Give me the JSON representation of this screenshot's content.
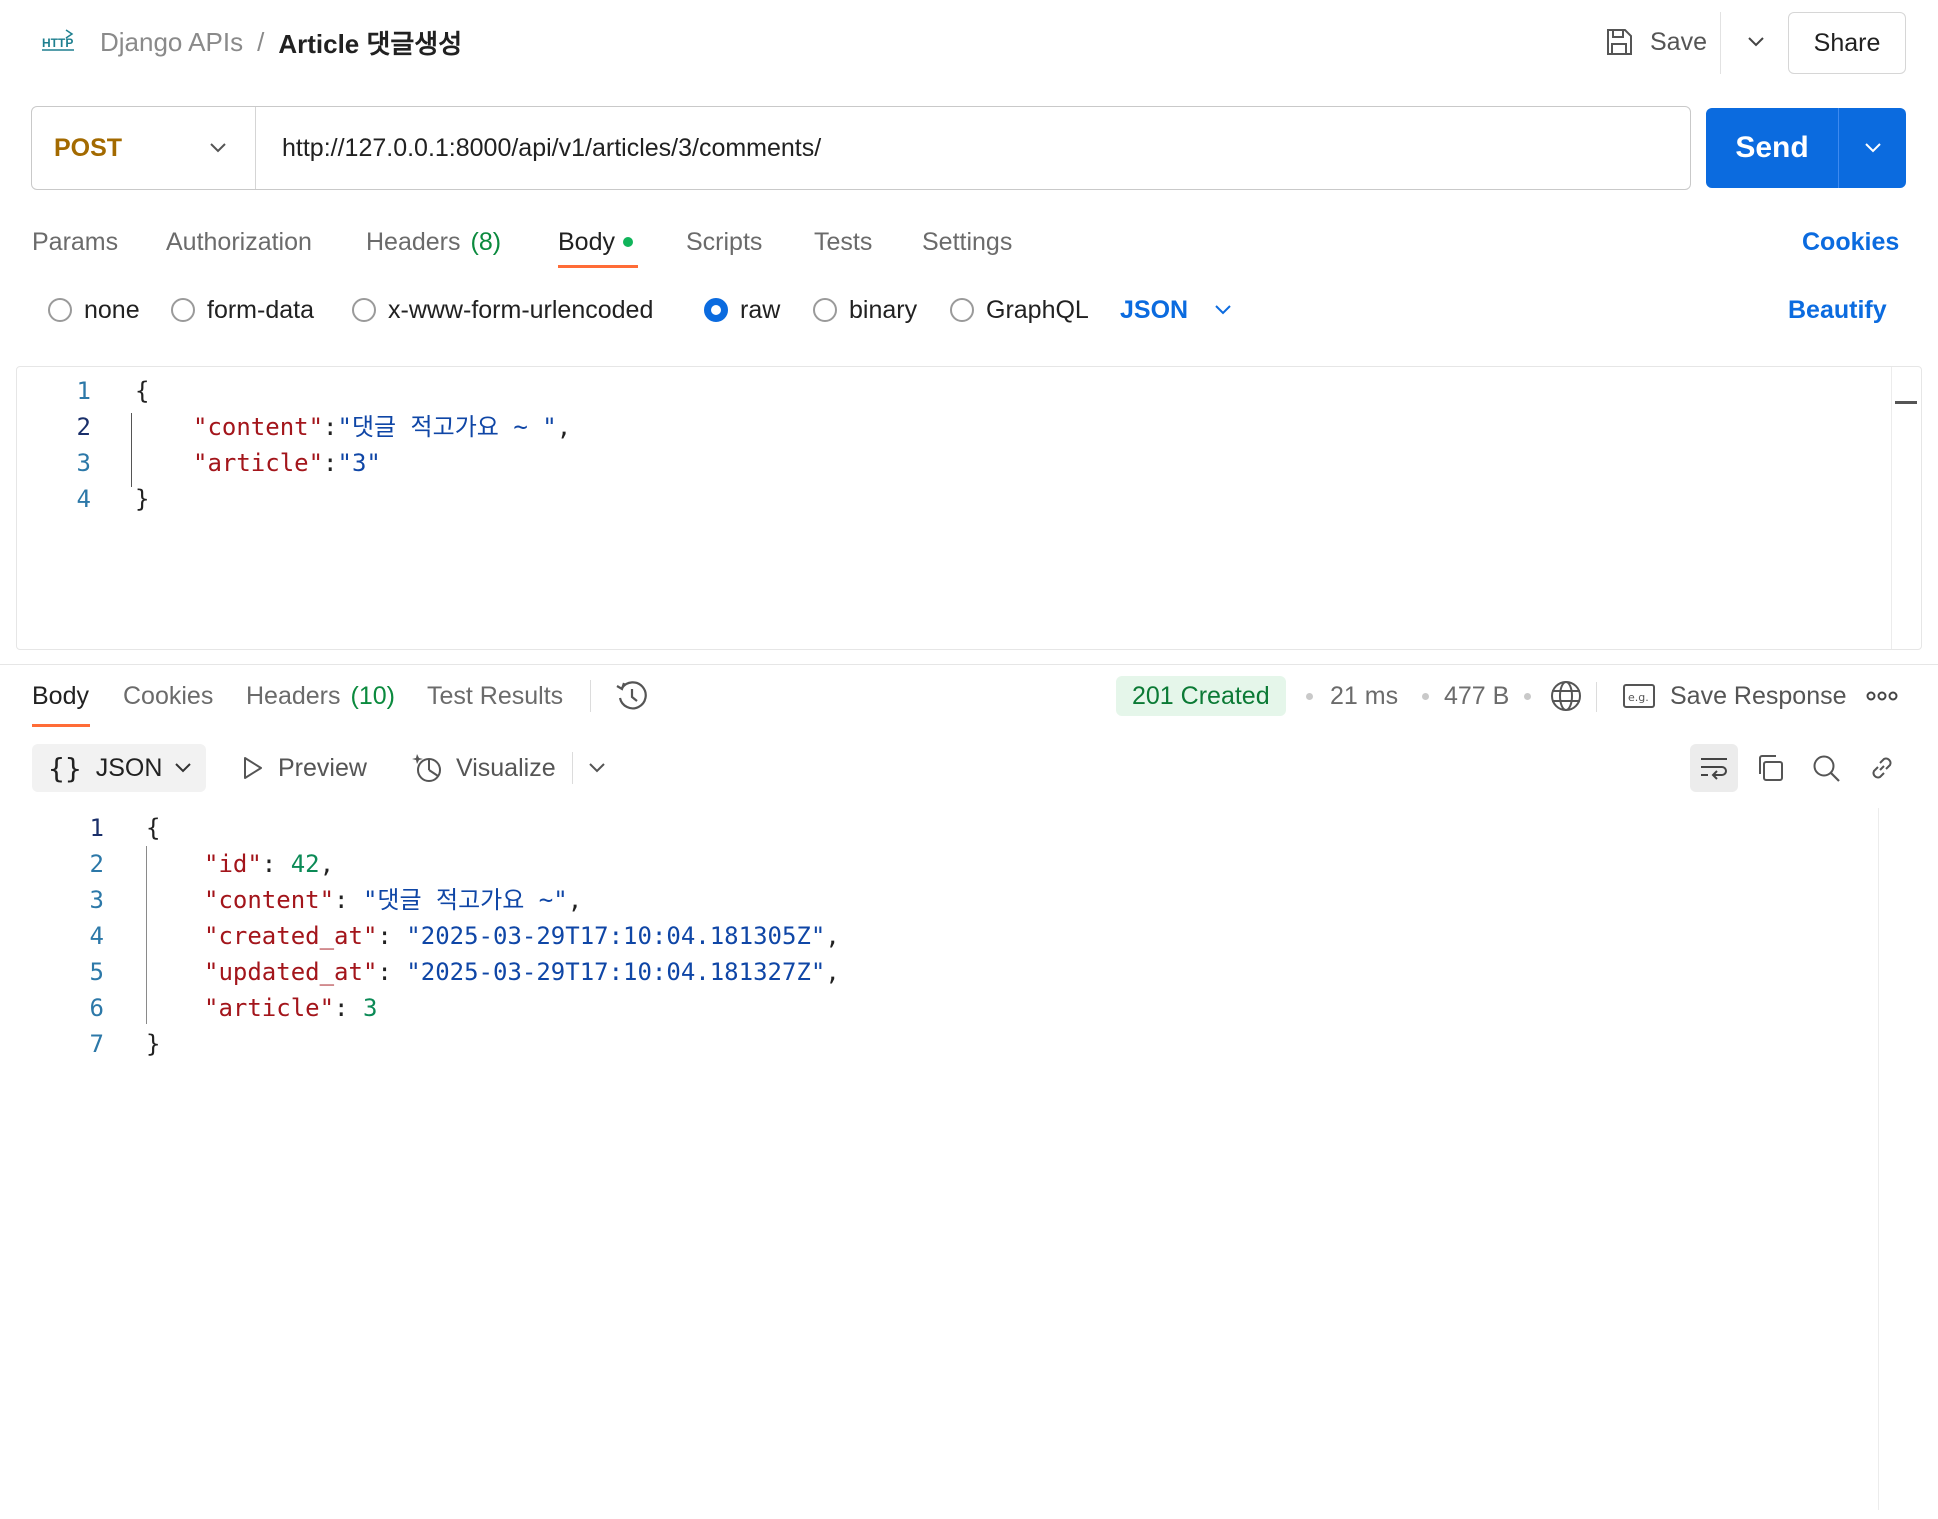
{
  "header": {
    "collection": "Django APIs",
    "separator": "/",
    "request_name": "Article 댓글생성",
    "save_label": "Save",
    "share_label": "Share"
  },
  "request": {
    "method": "POST",
    "url": "http://127.0.0.1:8000/api/v1/articles/3/comments/",
    "send_label": "Send",
    "tabs": {
      "params": "Params",
      "authorization": "Authorization",
      "headers": "Headers",
      "headers_count": "(8)",
      "body": "Body",
      "scripts": "Scripts",
      "tests": "Tests",
      "settings": "Settings"
    },
    "cookies_label": "Cookies",
    "body_types": {
      "none": "none",
      "form_data": "form-data",
      "urlencoded": "x-www-form-urlencoded",
      "raw": "raw",
      "binary": "binary",
      "graphql": "GraphQL"
    },
    "selected_body_type": "raw",
    "language": "JSON",
    "beautify_label": "Beautify",
    "body_lines": [
      {
        "n": "1",
        "text": "{"
      },
      {
        "n": "2",
        "key": "\"content\"",
        "colon": ":",
        "value": "\"댓글 적고가요 ~ \"",
        "end": ","
      },
      {
        "n": "3",
        "key": "\"article\"",
        "colon": ":",
        "value": "\"3\"",
        "end": ""
      },
      {
        "n": "4",
        "text": "}"
      }
    ]
  },
  "response": {
    "tabs": {
      "body": "Body",
      "cookies": "Cookies",
      "headers": "Headers",
      "headers_count": "(10)",
      "test_results": "Test Results"
    },
    "status": "201 Created",
    "time": "21 ms",
    "size": "477 B",
    "save_response_label": "Save Response",
    "format": "JSON",
    "preview_label": "Preview",
    "visualize_label": "Visualize",
    "body_lines": [
      {
        "n": "1",
        "text": "{"
      },
      {
        "n": "2",
        "key": "\"id\"",
        "colon": ": ",
        "value": "42",
        "end": ","
      },
      {
        "n": "3",
        "key": "\"content\"",
        "colon": ": ",
        "value": "\"댓글 적고가요 ~\"",
        "end": ","
      },
      {
        "n": "4",
        "key": "\"created_at\"",
        "colon": ": ",
        "value": "\"2025-03-29T17:10:04.181305Z\"",
        "end": ","
      },
      {
        "n": "5",
        "key": "\"updated_at\"",
        "colon": ": ",
        "value": "\"2025-03-29T17:10:04.181327Z\"",
        "end": ","
      },
      {
        "n": "6",
        "key": "\"article\"",
        "colon": ": ",
        "value": "3",
        "end": ""
      },
      {
        "n": "7",
        "text": "}"
      }
    ]
  },
  "colors": {
    "accent": "#0b6bdf",
    "method": "#a36a00",
    "tab_underline": "#ff6c37",
    "status_success": "#0b7a35"
  }
}
